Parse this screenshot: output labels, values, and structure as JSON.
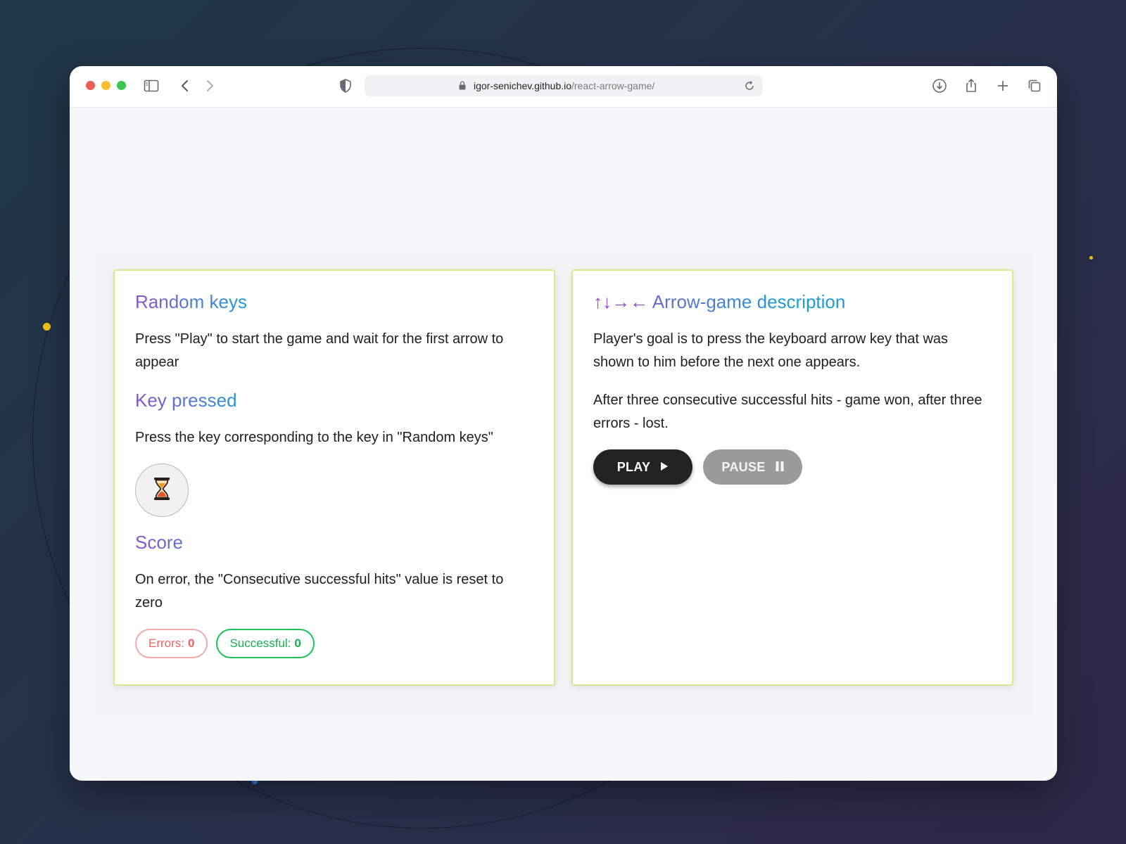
{
  "browser": {
    "url_host": "igor-senichev.github.io",
    "url_path": "/react-arrow-game/"
  },
  "left_card": {
    "random_keys": {
      "title": "Random keys",
      "text": "Press \"Play\" to start the game and wait for the first arrow to appear"
    },
    "key_pressed": {
      "title": "Key pressed",
      "text": "Press the key corresponding to the key in \"Random keys\"",
      "indicator_icon": "hourglass-icon"
    },
    "score": {
      "title": "Score",
      "text": "On error, the \"Consecutive successful hits\" value is reset to zero",
      "errors_label": "Errors:",
      "errors_value": "0",
      "successful_label": "Successful:",
      "successful_value": "0"
    }
  },
  "right_card": {
    "title_arrows": "↑↓→←",
    "title": "Arrow-game description",
    "paragraph_1": "Player's goal is to press the keyboard arrow key that was shown to him before the next one appears.",
    "paragraph_2": "After three consecutive successful hits - game won, after three errors - lost.",
    "play_label": "PLAY",
    "pause_label": "PAUSE"
  },
  "colors": {
    "card_border": "#dbe98e",
    "heading_gradient_start": "#8a54c8",
    "heading_gradient_end": "#1d9bd6",
    "errors": "#ef6461",
    "successful": "#15b04c",
    "play_button": "#232323",
    "pause_button": "#9a9a9a"
  }
}
